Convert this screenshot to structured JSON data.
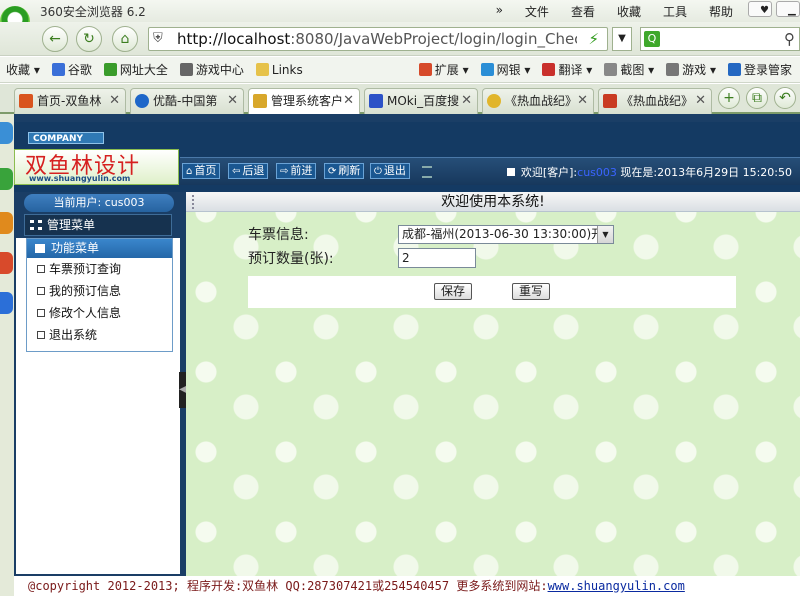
{
  "browser": {
    "title": "360安全浏览器 6.2",
    "menu": [
      "文件",
      "查看",
      "收藏",
      "工具",
      "帮助"
    ],
    "address_url_host": "http://localhost",
    "address_url_rest": ":8080/JavaWebProject/login/login_CheckL",
    "favorites": [
      "收藏",
      "谷歌",
      "网址大全",
      "游戏中心",
      "Links",
      "扩展",
      "网银",
      "翻译",
      "截图",
      "游戏",
      "登录管家"
    ],
    "tabs": [
      {
        "label": "首页-双鱼林",
        "color": "#d9541e"
      },
      {
        "label": "优酷-中国第",
        "color": "#1e67c9"
      },
      {
        "label": "管理系统客户",
        "color": "#d8a72b"
      },
      {
        "label": "MOki_百度搜",
        "color": "#2c52c7"
      },
      {
        "label": "《热血战纪》",
        "color": "#e1b52b"
      },
      {
        "label": "《热血战纪》",
        "color": "#c93b22"
      }
    ]
  },
  "page": {
    "company_label": "COMPANY",
    "brand_name": "双鱼林设计",
    "brand_url": "www.shuangyulin.com",
    "nav": {
      "home": "首页",
      "back": "后退",
      "forward": "前进",
      "refresh": "刷新",
      "logout": "退出"
    },
    "welcome_prefix": "欢迎[客户]:",
    "customer_id": "cus003",
    "now_label": "现在是:",
    "datetime": "2013年6月29日 15:20:50",
    "current_user": "当前用户: cus003",
    "manage_menu": "管理菜单",
    "function_menu": "功能菜单",
    "function_items": [
      "车票预订查询",
      "我的预订信息",
      "修改个人信息",
      "退出系统"
    ],
    "main_title": "欢迎使用本系统!",
    "form": {
      "ticket_label": "车票信息:",
      "ticket_value": "成都-福州(2013-06-30 13:30:00)开",
      "quantity_label": "预订数量(张):",
      "quantity_value": "2",
      "save_button": "保存",
      "reset_button": "重写"
    },
    "footer": {
      "text": "@copyright 2012-2013; 程序开发:双鱼林  QQ:287307421或254540457  更多系统到网站:",
      "link": "www.shuangyulin.com"
    }
  }
}
